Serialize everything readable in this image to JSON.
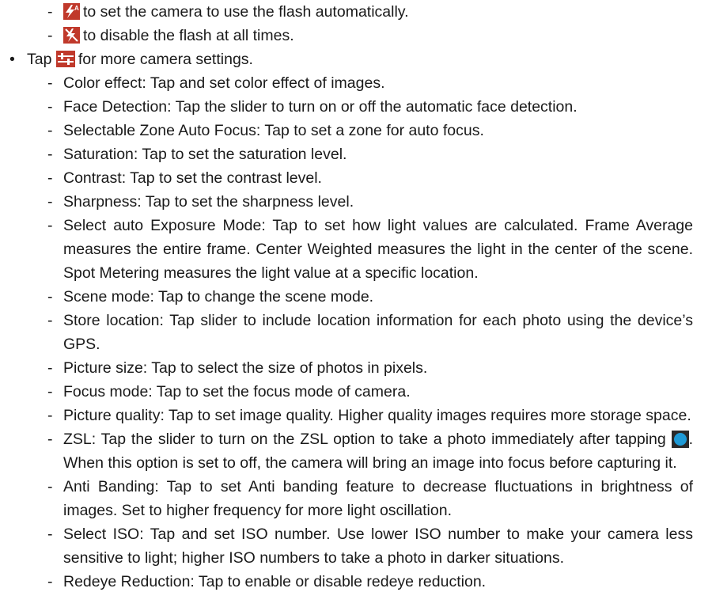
{
  "flash_options": [
    {
      "icon": "flash-auto-icon",
      "text": "to set the camera to use the flash automatically."
    },
    {
      "icon": "flash-off-icon",
      "text": "to disable the flash at all times."
    }
  ],
  "settings_intro": {
    "before": "Tap",
    "icon": "settings-sliders-icon",
    "after": "for more camera settings."
  },
  "items": [
    "Color effect: Tap and set color effect of images.",
    "Face Detection: Tap the slider to turn on or off the automatic face detection.",
    "Selectable Zone Auto Focus: Tap to set a zone for auto focus.",
    "Saturation: Tap to set the saturation level.",
    "Contrast: Tap to set the contrast level.",
    "Sharpness: Tap to set the sharpness level.",
    "Select auto Exposure Mode: Tap to set how light values are calculated. Frame Average measures the entire frame. Center Weighted measures the light in the center of the scene. Spot Metering measures the light value at a specific location.",
    "Scene mode: Tap to change the scene mode.",
    "Store location: Tap slider to include location information for each photo using the device’s GPS.",
    "Picture size: Tap to select the size of photos in pixels.",
    "Focus mode: Tap to set the focus mode of camera.",
    "Picture quality: Tap to set image quality. Higher quality images requires more storage space."
  ],
  "zsl": {
    "before": "ZSL: Tap the slider to turn on the ZSL option to take a photo immediately after tapping",
    "icon": "shutter-button-icon",
    "after": ". When this option is set to off, the camera will bring an image into focus before capturing it."
  },
  "items_after": [
    "Anti Banding: Tap to set Anti banding feature to decrease fluctuations in brightness of images. Set to higher frequency for more light oscillation.",
    "Select ISO: Tap and set ISO number. Use lower ISO number to make your camera less sensitive to light; higher ISO numbers to take a photo in darker situations.",
    "Redeye Reduction: Tap to enable or disable redeye reduction."
  ],
  "colors": {
    "icon_bg": "#c0392b",
    "shutter": "#1e9ad6",
    "text": "#1a1a1a"
  }
}
